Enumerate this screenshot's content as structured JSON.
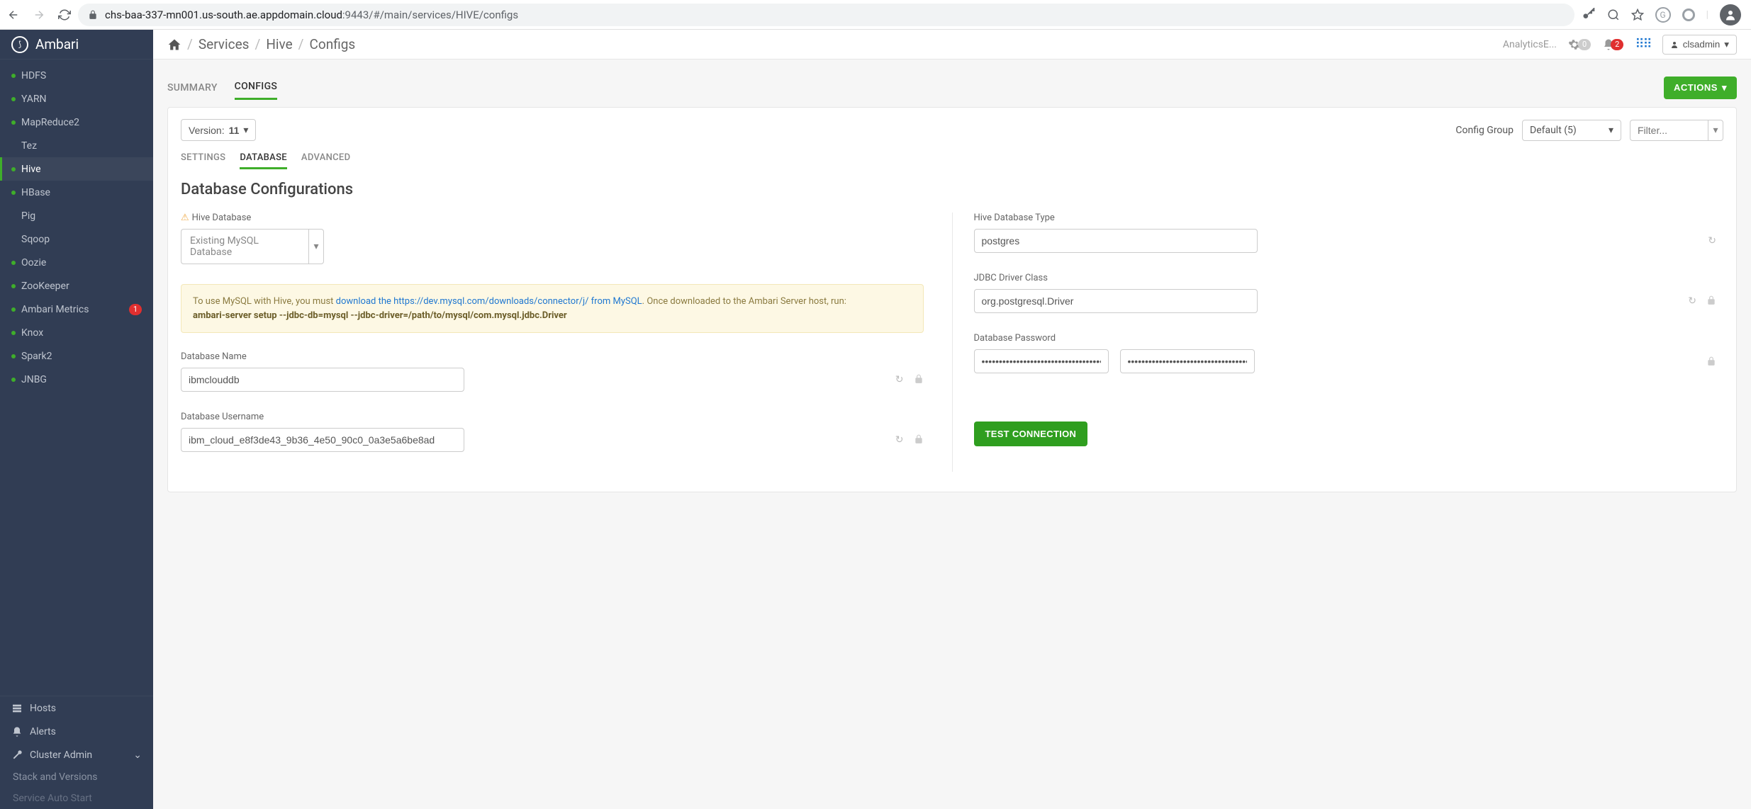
{
  "browser": {
    "url_host": "chs-baa-337-mn001.us-south.ae.appdomain.cloud",
    "url_port": ":9443",
    "url_path": "/#/main/services/HIVE/configs"
  },
  "sidebar": {
    "brand": "Ambari",
    "services": [
      {
        "label": "HDFS",
        "dot": true
      },
      {
        "label": "YARN",
        "dot": true
      },
      {
        "label": "MapReduce2",
        "dot": true
      },
      {
        "label": "Tez",
        "dot": false
      },
      {
        "label": "Hive",
        "dot": true,
        "active": true
      },
      {
        "label": "HBase",
        "dot": true
      },
      {
        "label": "Pig",
        "dot": false
      },
      {
        "label": "Sqoop",
        "dot": false
      },
      {
        "label": "Oozie",
        "dot": true
      },
      {
        "label": "ZooKeeper",
        "dot": true
      },
      {
        "label": "Ambari Metrics",
        "dot": true,
        "badge": "1"
      },
      {
        "label": "Knox",
        "dot": true
      },
      {
        "label": "Spark2",
        "dot": true
      },
      {
        "label": "JNBG",
        "dot": true
      }
    ],
    "lower": {
      "hosts": "Hosts",
      "alerts": "Alerts",
      "cluster_admin": "Cluster Admin",
      "stack_versions": "Stack and Versions",
      "service_auto_start": "Service Auto Start"
    }
  },
  "topbar": {
    "breadcrumb": {
      "services": "Services",
      "hive": "Hive",
      "configs": "Configs"
    },
    "cluster_name": "AnalyticsE...",
    "gear_count": "0",
    "bell_count": "2",
    "user": "clsadmin"
  },
  "tabs": {
    "summary": "SUMMARY",
    "configs": "CONFIGS",
    "actions": "ACTIONS"
  },
  "controls": {
    "version_label": "Version:",
    "version_value": "11",
    "config_group_label": "Config Group",
    "config_group_value": "Default (5)",
    "filter_placeholder": "Filter..."
  },
  "subtabs": {
    "settings": "SETTINGS",
    "database": "DATABASE",
    "advanced": "ADVANCED"
  },
  "section": {
    "title": "Database Configurations",
    "left": {
      "hive_database_label": "Hive Database",
      "hive_database_value": "Existing MySQL Database",
      "info_prefix": "To use MySQL with Hive, you must ",
      "info_link1": "download the https://dev.mysql.com/downloads/connector/j/ from MySQL",
      "info_mid": ". Once downloaded to the Ambari Server host, run:",
      "info_cmd": "ambari-server setup --jdbc-db=mysql --jdbc-driver=/path/to/mysql/com.mysql.jdbc.Driver",
      "dbname_label": "Database Name",
      "dbname_value": "ibmclouddb",
      "dbuser_label": "Database Username",
      "dbuser_value": "ibm_cloud_e8f3de43_9b36_4e50_90c0_0a3e5a6be8ad"
    },
    "right": {
      "dbtype_label": "Hive Database Type",
      "dbtype_value": "postgres",
      "jdbc_label": "JDBC Driver Class",
      "jdbc_value": "org.postgresql.Driver",
      "dbpass_label": "Database Password",
      "test_btn": "TEST CONNECTION"
    }
  }
}
